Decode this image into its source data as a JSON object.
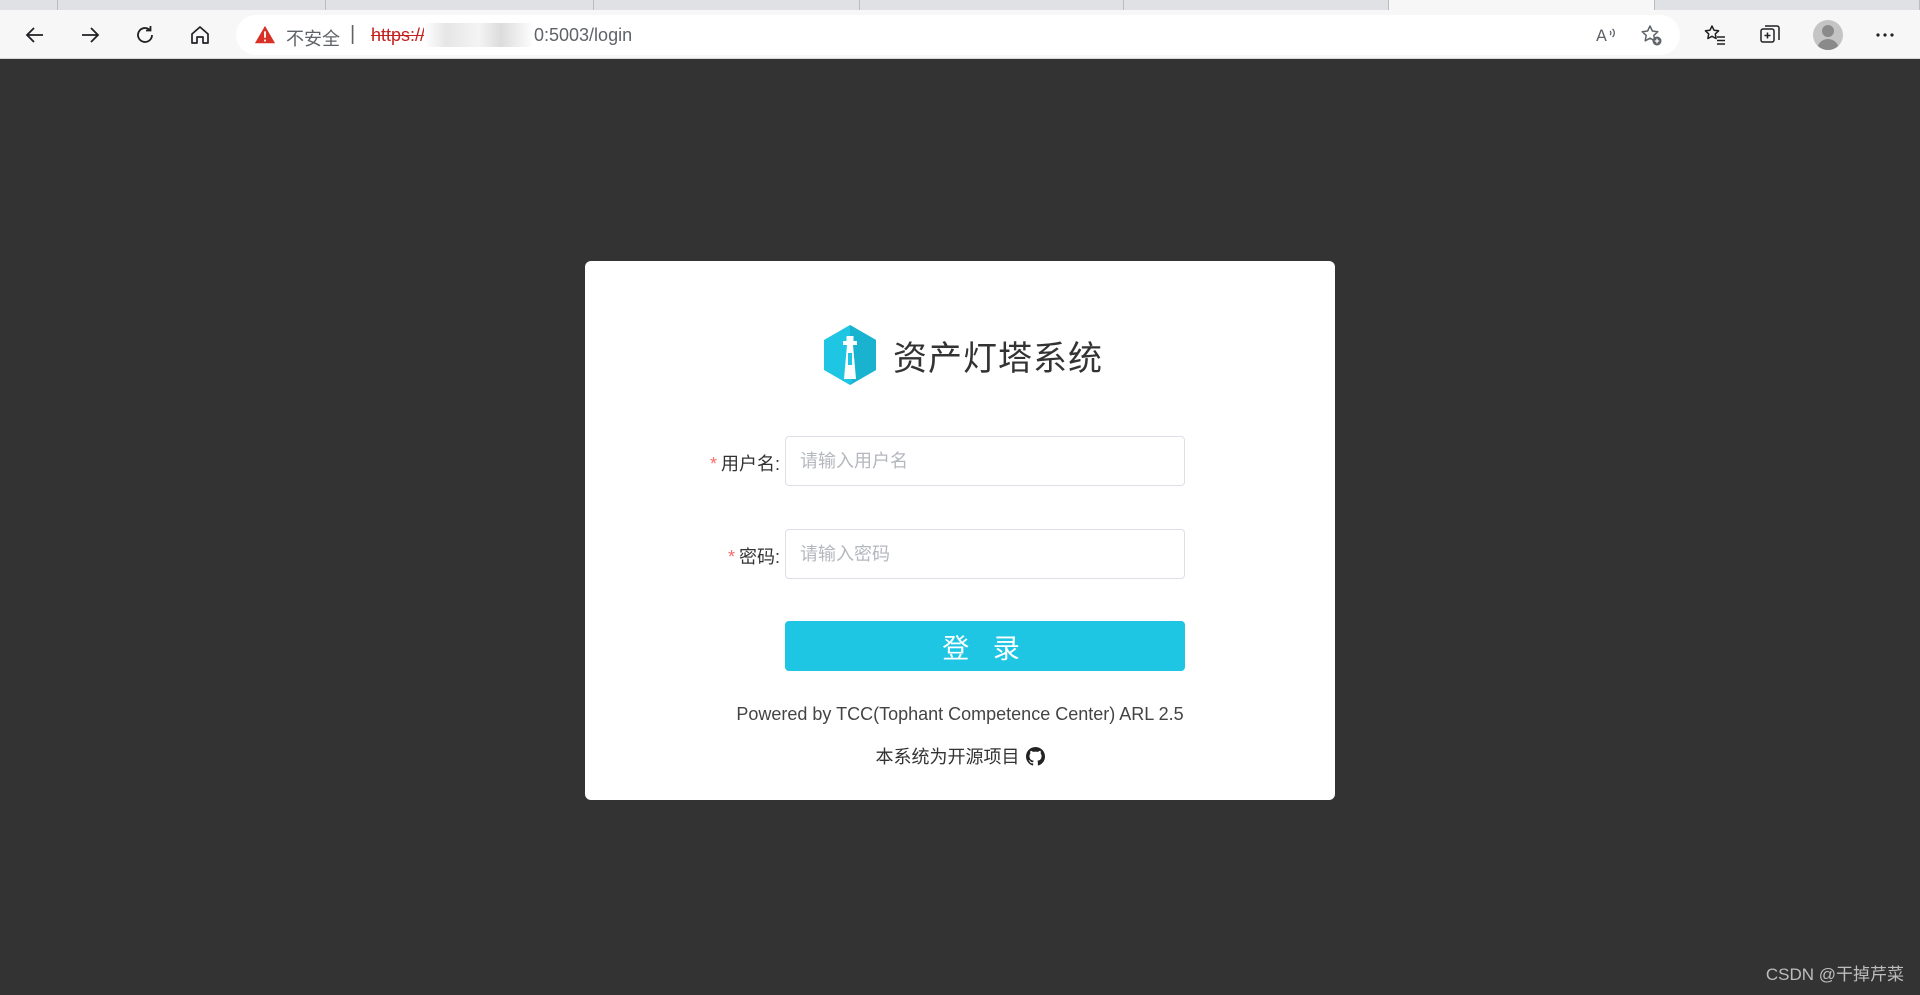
{
  "browser": {
    "security_label": "不安全",
    "separator": "|",
    "url_scheme": "https://",
    "url_path": "0:5003/login",
    "read_aloud_glyph": "A⁾"
  },
  "colors": {
    "accent": "#1ec6e4",
    "page_bg": "#333333",
    "required": "#f56c6c",
    "warning": "#d93025"
  },
  "login": {
    "system_title": "资产灯塔系统",
    "username_label": "用户名:",
    "username_placeholder": "请输入用户名",
    "password_label": "密码:",
    "password_placeholder": "请输入密码",
    "required_mark": "*",
    "login_button": "登 录",
    "powered_by": "Powered by TCC(Tophant Competence Center) ARL 2.5",
    "open_source": "本系统为开源项目"
  },
  "watermark": "CSDN @干掉芹菜"
}
